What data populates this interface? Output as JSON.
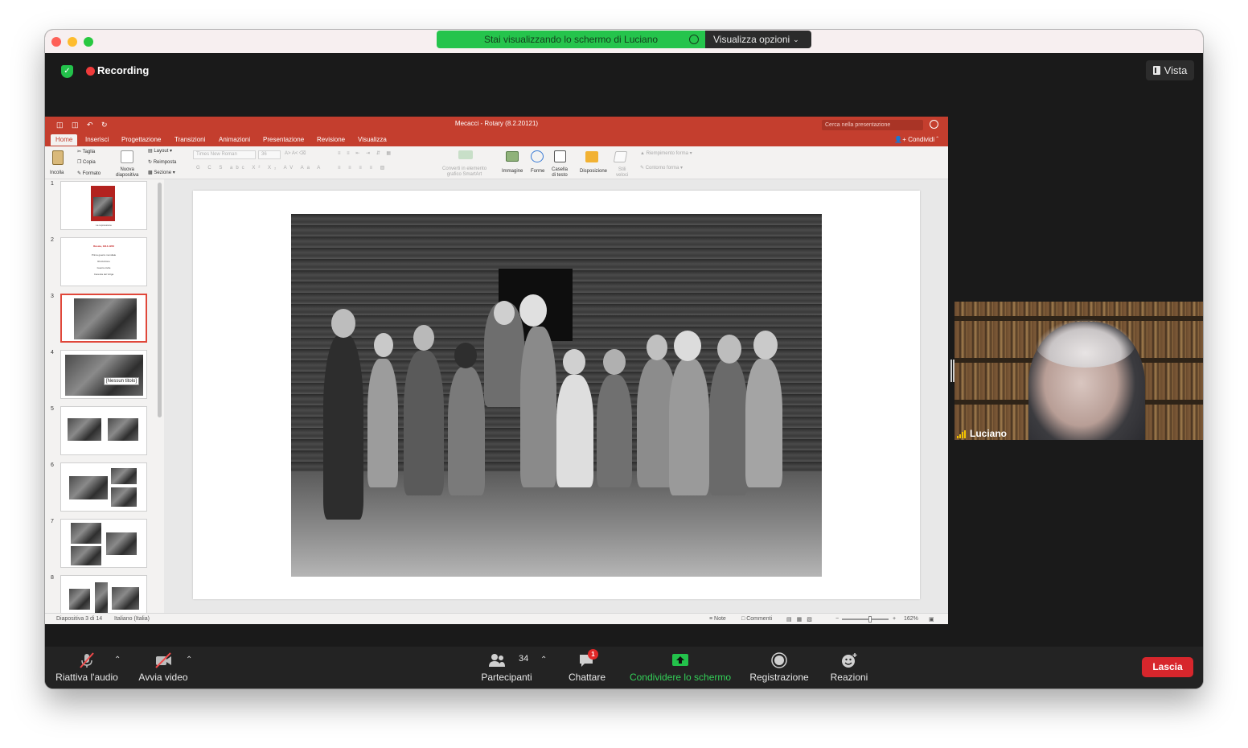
{
  "share_banner": {
    "text": "Stai visualizzando lo schermo di Luciano",
    "options_label": "Visualizza opzioni"
  },
  "meeting": {
    "recording_label": "Recording",
    "view_label": "Vista"
  },
  "powerpoint": {
    "title": "Mecacci - Rotary (8.2.20121)",
    "search_placeholder": "Cerca nella presentazione",
    "tabs": [
      "Home",
      "Inserisci",
      "Progettazione",
      "Transizioni",
      "Animazioni",
      "Presentazione",
      "Revisione",
      "Visualizza"
    ],
    "share_label": "Condividi",
    "ribbon": {
      "paste": "Incolla",
      "cut": "Taglia",
      "copy": "Copia",
      "format": "Formato",
      "new_slide_1": "Nuova",
      "new_slide_2": "diapositiva",
      "layout": "Layout",
      "reset": "Reimposta",
      "section": "Sezione",
      "font_name": "Times New Roman",
      "font_size": "36",
      "smartart_1": "Converti in elemento",
      "smartart_2": "grafico SmartArt",
      "image": "Immagine",
      "shapes": "Forme",
      "textbox_1": "Casella",
      "textbox_2": "di testo",
      "arrange": "Disposizione",
      "quick_styles_1": "Stili",
      "quick_styles_2": "veloci",
      "shape_fill": "Riempimento forma",
      "shape_outline": "Contorno forma"
    },
    "thumbnails": [
      {
        "num": "1",
        "caption": "La repressione"
      },
      {
        "num": "2",
        "title": "Russia, 1914-1953",
        "lines": [
          "Prima guerra mondiale",
          "Rivoluzione",
          "Guerra civile",
          "Carestia del Volga"
        ]
      },
      {
        "num": "3"
      },
      {
        "num": "4",
        "tooltip": "[Nessun titolo]"
      },
      {
        "num": "5"
      },
      {
        "num": "6"
      },
      {
        "num": "7"
      },
      {
        "num": "8"
      }
    ],
    "status": {
      "slide_info": "Diapositiva 3 di 14",
      "language": "Italiano (Italia)",
      "notes": "Note",
      "comments": "Commenti",
      "zoom": "162%"
    }
  },
  "video": {
    "participant_name": "Luciano"
  },
  "toolbar": {
    "unmute": "Riattiva l'audio",
    "start_video": "Avvia video",
    "participants": "Partecipanti",
    "participants_count": "34",
    "chat": "Chattare",
    "chat_badge": "1",
    "share_screen": "Condividere lo schermo",
    "recording": "Registrazione",
    "reactions": "Reazioni",
    "leave": "Lascia"
  },
  "colors": {
    "ppt_red": "#c43e2e",
    "share_green": "#25c44c",
    "leave_red": "#d7262c",
    "recording_red": "#ef3b3b"
  }
}
